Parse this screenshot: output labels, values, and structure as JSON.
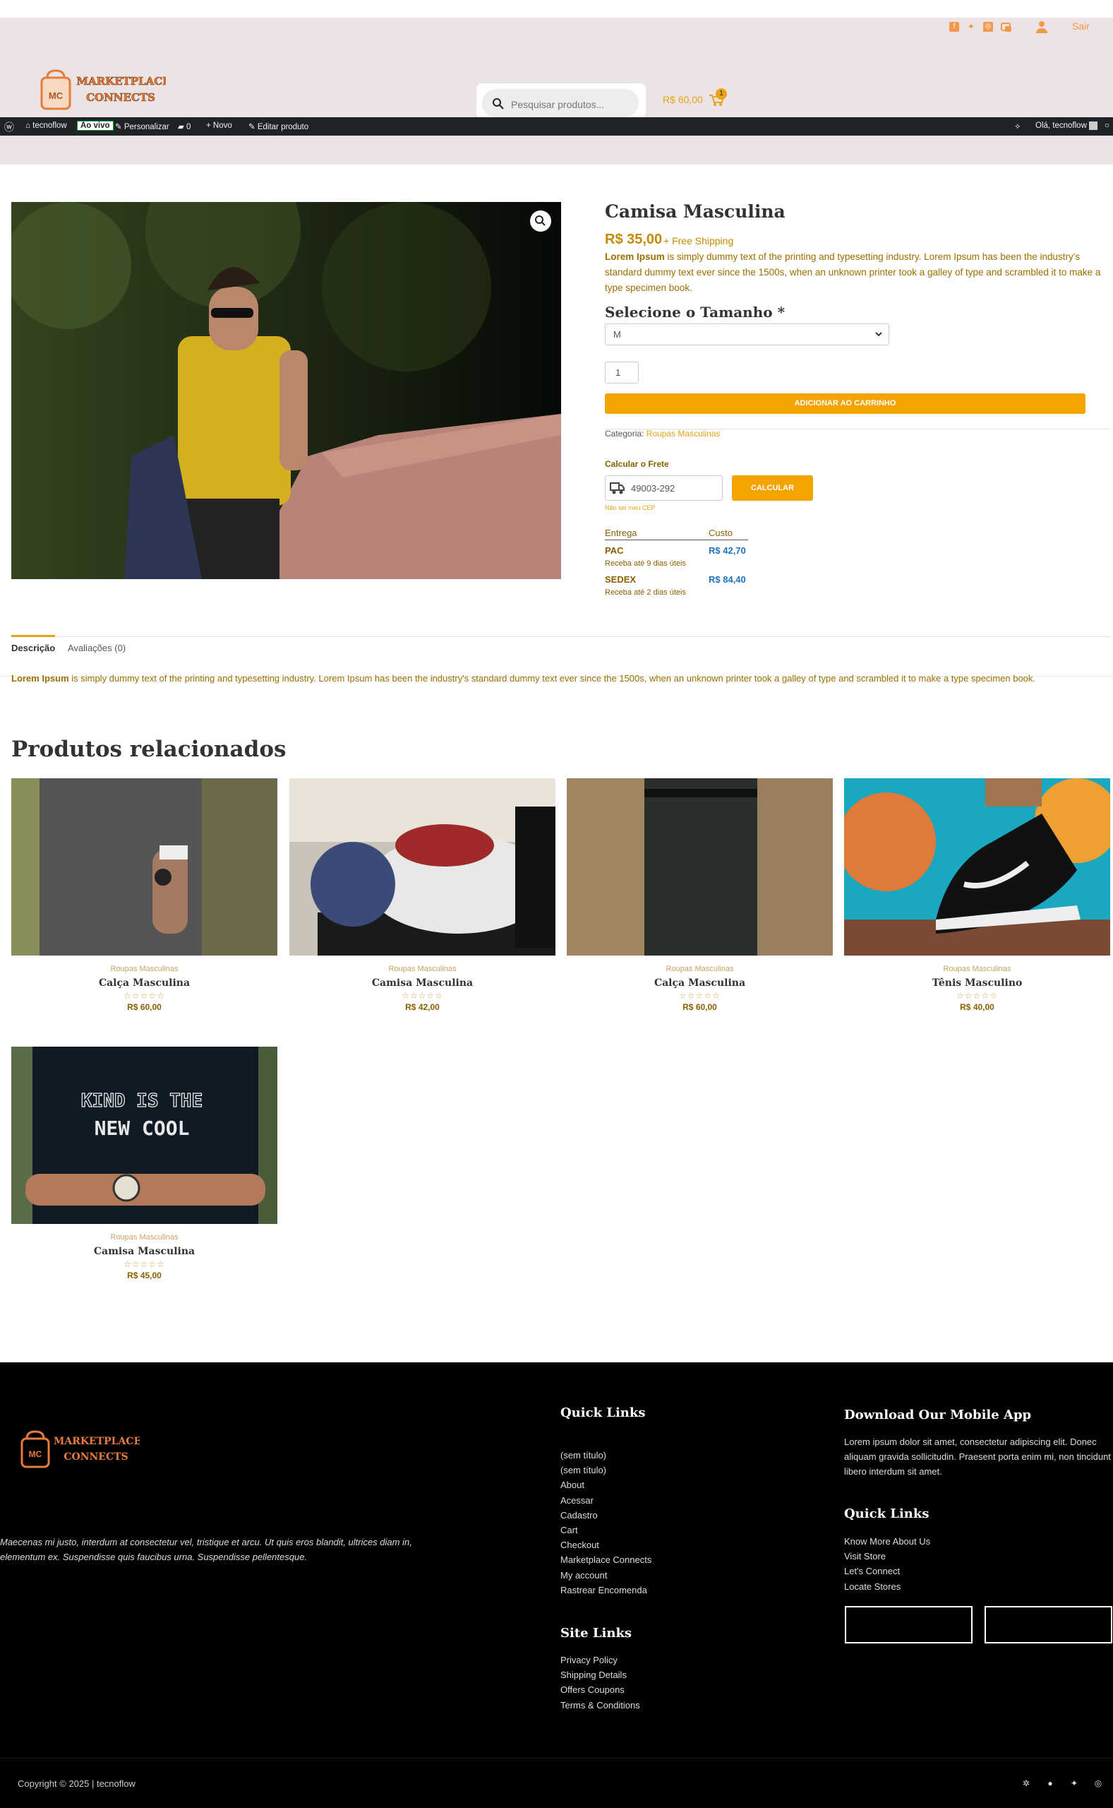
{
  "header": {
    "social_icons": [
      "facebook-icon",
      "twitter-icon",
      "instagram-icon",
      "chat-icon"
    ],
    "logout": "Sair",
    "logo_line1": "MARKETPLACE",
    "logo_line2": "CONNECTS",
    "logo_badge": "MC",
    "search_placeholder": "Pesquisar produtos...",
    "cart_total": "R$ 60,00",
    "cart_count": "1",
    "accent": "#e8a316"
  },
  "admin_bar": {
    "site": "tecnoflow",
    "live": "Ao vivo",
    "customize": "Personalizar",
    "comments": "0",
    "new": "Novo",
    "edit": "Editar produto",
    "greeting": "Olá, tecnoflow"
  },
  "product": {
    "title": "Camisa Masculina",
    "price": "R$ 35,00",
    "shipping_note": "+ Free Shipping",
    "desc_bold": "Lorem Ipsum",
    "desc_rest": " is simply dummy text of the printing and typesetting industry. Lorem Ipsum has been the industry's standard dummy text ever since the 1500s, when an unknown printer took a galley of type and scrambled it to make a type specimen book.",
    "size_label": "Selecione o Tamanho *",
    "size_value": "M",
    "quantity": "1",
    "add_to_cart": "ADICIONAR AO CARRINHO",
    "category_label": "Categoria:",
    "category": "Roupas Masculinas"
  },
  "shipping": {
    "title": "Calcular o Frete",
    "cep": "49003-292",
    "button": "CALCULAR",
    "no_cep": "Não sei meu CEP",
    "col_delivery": "Entrega",
    "col_cost": "Custo",
    "options": [
      {
        "name": "PAC",
        "detail": "Receba até 9 dias úteis",
        "price": "R$ 42,70"
      },
      {
        "name": "SEDEX",
        "detail": "Receba até 2 dias úteis",
        "price": "R$ 84,40"
      }
    ]
  },
  "tabs": {
    "description": "Descrição",
    "reviews": "Avaliações (0)",
    "desc_bold": "Lorem Ipsum",
    "desc_rest": " is simply dummy text of the printing and typesetting industry. Lorem Ipsum has been the industry's standard dummy text ever since the 1500s, when an unknown printer took a galley of type and scrambled it to make a type specimen book."
  },
  "related": {
    "title": "Produtos relacionados",
    "items": [
      {
        "category": "Roupas Masculinas",
        "name": "Calça Masculina",
        "stars": "☆☆☆☆☆",
        "price": "R$ 60,00"
      },
      {
        "category": "Roupas Masculinas",
        "name": "Camisa Masculina",
        "stars": "☆☆☆☆☆",
        "price": "R$ 42,00"
      },
      {
        "category": "Roupas Masculinas",
        "name": "Calça Masculina",
        "stars": "☆☆☆☆☆",
        "price": "R$ 60,00"
      },
      {
        "category": "Roupas Masculinas",
        "name": "Tênis Masculino",
        "stars": "☆☆☆☆☆",
        "price": "R$ 40,00"
      },
      {
        "category": "Roupas Masculinas",
        "name": "Camisa Masculina",
        "stars": "☆☆☆☆☆",
        "price": "R$ 45,00"
      }
    ],
    "tshirt_text1": "KIND IS THE",
    "tshirt_text2": "NEW COOL"
  },
  "footer": {
    "logo_line1": "MARKETPLACE",
    "logo_line2": "CONNECTS",
    "logo_badge": "MC",
    "quote": "Maecenas mi justo, interdum at consectetur vel, tristique et arcu. Ut quis eros blandit, ultrices diam in, elementum ex. Suspendisse quis faucibus urna. Suspendisse pellentesque.",
    "quick_links_title": "Quick Links",
    "quick_links": [
      "(sem título)",
      "(sem título)",
      "About",
      "Acessar",
      "Cadastro",
      "Cart",
      "Checkout",
      "Marketplace Connects",
      "My account",
      "Rastrear Encomenda"
    ],
    "site_links_title": "Site Links",
    "site_links": [
      "Privacy Policy",
      "Shipping Details",
      "Offers Coupons",
      "Terms & Conditions"
    ],
    "app_title": "Download Our Mobile App",
    "app_text": "Lorem ipsum dolor sit amet, consectetur adipiscing elit. Donec aliquam gravida sollicitudin. Praesent porta enim mi, non tincidunt libero interdum sit amet.",
    "quick_links2_title": "Quick Links",
    "quick_links2": [
      "Know More About Us",
      "Visit Store",
      "Let's Connect",
      "Locate Stores"
    ],
    "copyright": "Copyright © 2025 | tecnoflow"
  }
}
